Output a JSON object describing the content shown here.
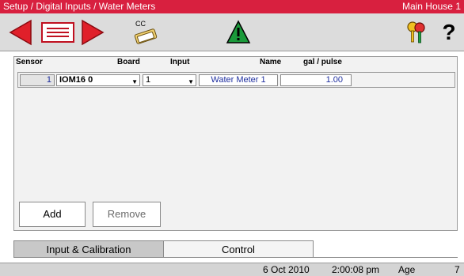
{
  "title_bar": {
    "path": "Setup / Digital Inputs / Water Meters",
    "location": "Main House 1"
  },
  "toolbar": {
    "back_icon": "red-left-arrow-icon",
    "list_icon": "record-list-icon",
    "forward_icon": "red-right-arrow-icon",
    "copy_label": "CC",
    "copy_icon": "clipboard-copy-icon",
    "alarm_icon": "warning-triangle-icon",
    "keys_icon": "keys-icon",
    "help_label": "?"
  },
  "table": {
    "headers": {
      "sensor": "Sensor",
      "board": "Board",
      "input": "Input",
      "name": "Name",
      "gal_per_pulse": "gal / pulse"
    },
    "rows": [
      {
        "sensor": "1",
        "board": "IOM16 0",
        "input": "1",
        "name": "Water Meter 1",
        "gal_per_pulse": "1.00"
      }
    ]
  },
  "buttons": {
    "add": "Add",
    "remove": "Remove"
  },
  "tabs": {
    "input_calibration": "Input & Calibration",
    "control": "Control"
  },
  "status_bar": {
    "date": "6 Oct 2010",
    "time": "2:00:08 pm",
    "age_label": "Age",
    "age_value": "7"
  },
  "colors": {
    "title_bar": "#d8203f",
    "arrow_red": "#e0202a",
    "alarm_green": "#1a9a3a",
    "value_blue": "#2030a0"
  }
}
